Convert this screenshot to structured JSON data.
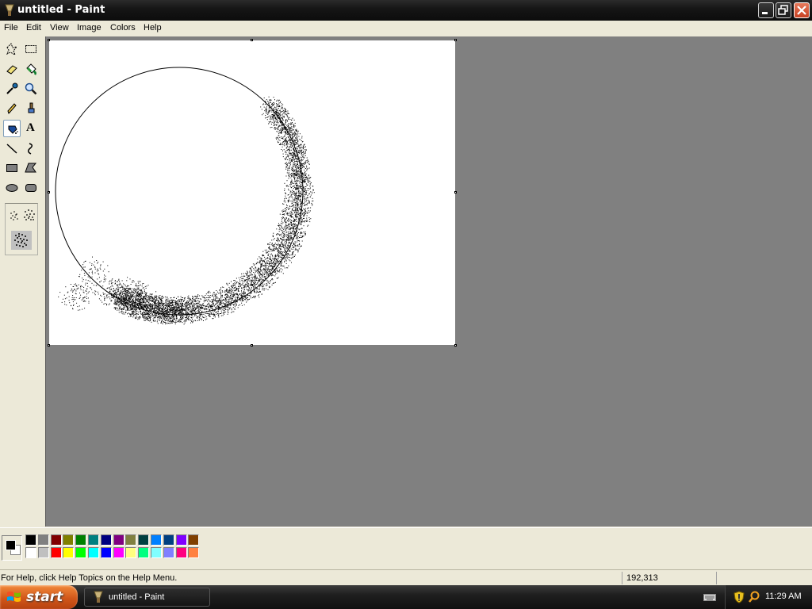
{
  "window": {
    "title": "untitled - Paint"
  },
  "menu": [
    "File",
    "Edit",
    "View",
    "Image",
    "Colors",
    "Help"
  ],
  "tools": [
    {
      "name": "free-form-select-icon",
      "selected": false
    },
    {
      "name": "select-icon",
      "selected": false
    },
    {
      "name": "eraser-icon",
      "selected": false
    },
    {
      "name": "fill-icon",
      "selected": false
    },
    {
      "name": "pick-color-icon",
      "selected": false
    },
    {
      "name": "magnifier-icon",
      "selected": false
    },
    {
      "name": "pencil-icon",
      "selected": false
    },
    {
      "name": "brush-icon",
      "selected": false
    },
    {
      "name": "airbrush-icon",
      "selected": true
    },
    {
      "name": "text-icon",
      "selected": false
    },
    {
      "name": "line-icon",
      "selected": false
    },
    {
      "name": "curve-icon",
      "selected": false
    },
    {
      "name": "rectangle-icon",
      "selected": false
    },
    {
      "name": "polygon-icon",
      "selected": false
    },
    {
      "name": "ellipse-icon",
      "selected": false
    },
    {
      "name": "rounded-rectangle-icon",
      "selected": false
    }
  ],
  "text_tool_glyph": "A",
  "palette": {
    "foreground": "#000000",
    "background": "#ffffff",
    "top_row": [
      "#000000",
      "#808080",
      "#800000",
      "#808000",
      "#008000",
      "#008080",
      "#000080",
      "#800080",
      "#808040",
      "#004040",
      "#0080ff",
      "#004080",
      "#8000ff",
      "#804000"
    ],
    "bottom_row": [
      "#ffffff",
      "#c0c0c0",
      "#ff0000",
      "#ffff00",
      "#00ff00",
      "#00ffff",
      "#0000ff",
      "#ff00ff",
      "#ffff80",
      "#00ff80",
      "#80ffff",
      "#8080ff",
      "#ff0080",
      "#ff8040"
    ]
  },
  "status": {
    "help_text": "For Help, click Help Topics on the Help Menu.",
    "coordinates": "192,313"
  },
  "taskbar": {
    "start_label": "start",
    "task_label": "untitled - Paint",
    "clock": "11:29 AM"
  }
}
